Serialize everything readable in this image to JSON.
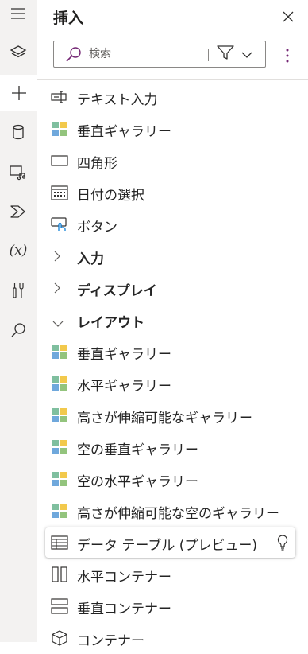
{
  "panel": {
    "title": "挿入",
    "search": {
      "placeholder": "検索",
      "value": ""
    }
  },
  "rail": {
    "items": [
      {
        "name": "hamburger-menu-icon"
      },
      {
        "name": "layers-icon"
      },
      {
        "name": "plus-icon",
        "active": true
      },
      {
        "name": "database-icon"
      },
      {
        "name": "media-icon"
      },
      {
        "name": "power-automate-icon"
      },
      {
        "name": "variables-icon",
        "text": "(x)"
      },
      {
        "name": "tools-icon"
      },
      {
        "name": "search-icon"
      }
    ]
  },
  "list": {
    "text_input": "テキスト入力",
    "vertical_gallery_top": "垂直ギャラリー",
    "rectangle": "四角形",
    "date_picker": "日付の選択",
    "button": "ボタン",
    "group_input": "入力",
    "group_display": "ディスプレイ",
    "group_layout": "レイアウト",
    "vertical_gallery": "垂直ギャラリー",
    "horizontal_gallery": "水平ギャラリー",
    "flexible_height_gallery": "高さが伸縮可能なギャラリー",
    "blank_vertical_gallery": "空の垂直ギャラリー",
    "blank_horizontal_gallery": "空の水平ギャラリー",
    "blank_flexible_height_gallery": "高さが伸縮可能な空のギャラリー",
    "data_table": "データ テーブル (プレビュー)",
    "horizontal_container": "水平コンテナー",
    "vertical_container": "垂直コンテナー",
    "container": "コンテナー"
  },
  "colors": {
    "gallery_tl": "#7fbf9f",
    "gallery_tr": "#f2c94c",
    "gallery_bl": "#6fa8dc",
    "gallery_br": "#93c47d",
    "icon_stroke": "#323130",
    "accent": "#742774"
  }
}
